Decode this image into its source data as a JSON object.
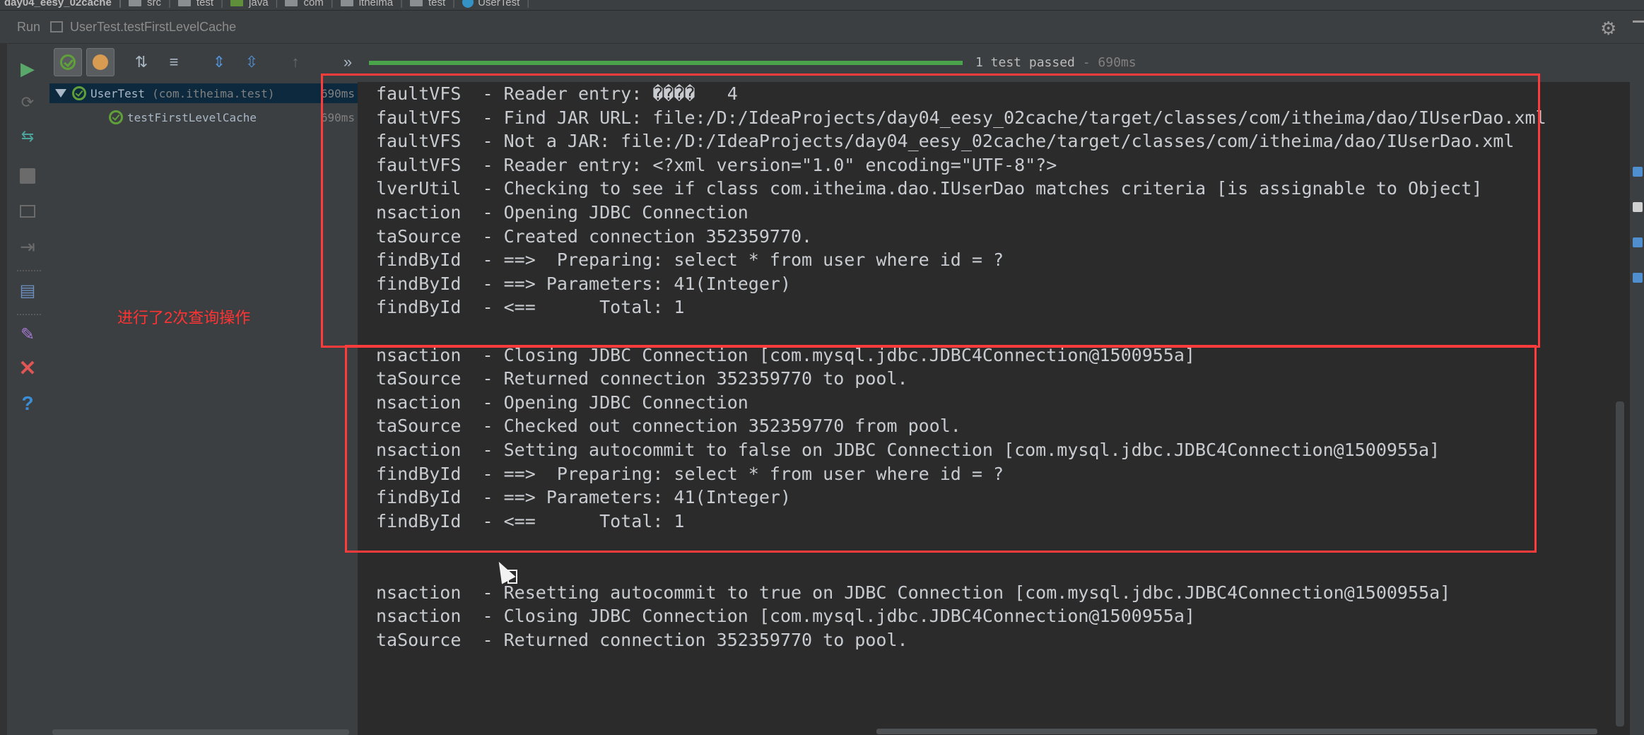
{
  "breadcrumb": {
    "items": [
      {
        "label": "day04_eesy_02cache",
        "icon": "project-icon"
      },
      {
        "label": "src",
        "icon": "folder-icon"
      },
      {
        "label": "test",
        "icon": "folder-icon"
      },
      {
        "label": "java",
        "icon": "java-folder-icon"
      },
      {
        "label": "com",
        "icon": "package-icon"
      },
      {
        "label": "itheima",
        "icon": "package-icon"
      },
      {
        "label": "test",
        "icon": "package-icon"
      },
      {
        "label": "UserTest",
        "icon": "class-icon"
      }
    ]
  },
  "run_bar": {
    "label": "Run",
    "config": "UserTest.testFirstLevelCache"
  },
  "toolbar": {
    "status_text": "1 test passed",
    "status_sep": " - ",
    "status_time": "690ms",
    "progress": 1.0,
    "more": "»"
  },
  "tree": {
    "root": {
      "name": "UserTest",
      "package": "(com.itheima.test)",
      "time": "690ms"
    },
    "children": [
      {
        "name": "testFirstLevelCache",
        "time": "690ms"
      }
    ]
  },
  "annotation": "进行了2次查询操作",
  "console": {
    "lines": [
      "faultVFS  - Reader entry: ����   4",
      "faultVFS  - Find JAR URL: file:/D:/IdeaProjects/day04_eesy_02cache/target/classes/com/itheima/dao/IUserDao.xml",
      "faultVFS  - Not a JAR: file:/D:/IdeaProjects/day04_eesy_02cache/target/classes/com/itheima/dao/IUserDao.xml",
      "faultVFS  - Reader entry: <?xml version=\"1.0\" encoding=\"UTF-8\"?>",
      "lverUtil  - Checking to see if class com.itheima.dao.IUserDao matches criteria [is assignable to Object]",
      "nsaction  - Opening JDBC Connection",
      "taSource  - Created connection 352359770.",
      "findById  - ==>  Preparing: select * from user where id = ?",
      "findById  - ==> Parameters: 41(Integer)",
      "findById  - <==      Total: 1",
      "",
      "nsaction  - Closing JDBC Connection [com.mysql.jdbc.JDBC4Connection@1500955a]",
      "taSource  - Returned connection 352359770 to pool.",
      "nsaction  - Opening JDBC Connection",
      "taSource  - Checked out connection 352359770 from pool.",
      "nsaction  - Setting autocommit to false on JDBC Connection [com.mysql.jdbc.JDBC4Connection@1500955a]",
      "findById  - ==>  Preparing: select * from user where id = ?",
      "findById  - ==> Parameters: 41(Integer)",
      "findById  - <==      Total: 1",
      "",
      "",
      "nsaction  - Resetting autocommit to true on JDBC Connection [com.mysql.jdbc.JDBC4Connection@1500955a]",
      "nsaction  - Closing JDBC Connection [com.mysql.jdbc.JDBC4Connection@1500955a]",
      "taSource  - Returned connection 352359770 to pool."
    ]
  },
  "colors": {
    "accent_green": "#5fa03a",
    "annotation_red": "#ff3333",
    "background": "#2b2b2b"
  }
}
